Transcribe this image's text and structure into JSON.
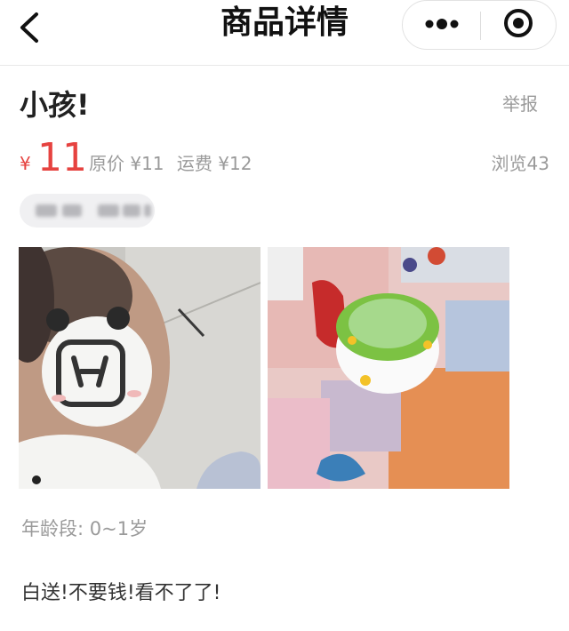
{
  "navbar": {
    "title": "商品详情",
    "back_icon": "chevron-left-icon",
    "more_icon": "more-dots-icon",
    "close_icon": "target-close-icon"
  },
  "goods": {
    "title": "小孩!",
    "report_label": "举报",
    "currency": "¥",
    "price": "11",
    "original_price": "原价 ¥11",
    "shipping": "运费 ¥12",
    "views": "浏览43",
    "age_label": "年龄段: 0~1岁",
    "description": "白送!不要钱!看不了了!"
  },
  "colors": {
    "price_red": "#e64340",
    "muted_gray": "#9a9a9a",
    "pill_bg": "#f0f0f2"
  }
}
